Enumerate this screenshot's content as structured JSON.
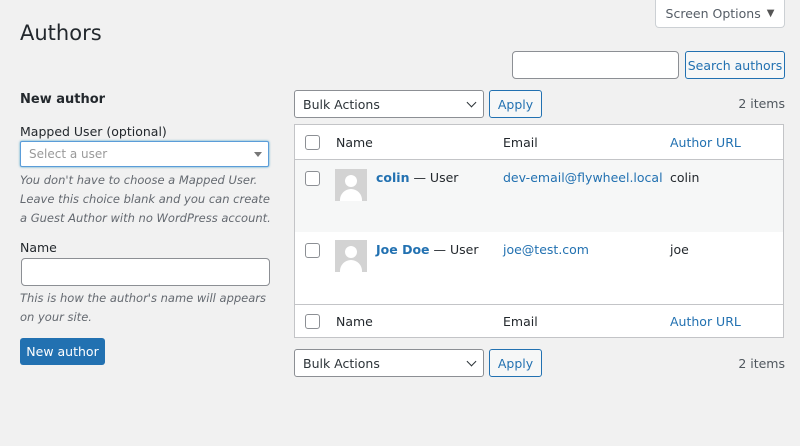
{
  "header": {
    "title": "Authors",
    "screen_options": "Screen Options",
    "search_button": "Search authors",
    "search_value": ""
  },
  "form": {
    "heading": "New author",
    "mapped_user_label": "Mapped User (optional)",
    "mapped_user_placeholder": "Select a user",
    "mapped_user_desc": "You don't have to choose a Mapped User. Leave this choice blank and you can create a Guest Author with no WordPress account.",
    "name_label": "Name",
    "name_value": "",
    "name_desc": "This is how the author's name will appears on your site.",
    "submit_label": "New author"
  },
  "bulk_top": {
    "action": "Bulk Actions",
    "apply": "Apply",
    "count": "2 items"
  },
  "bulk_bottom": {
    "action": "Bulk Actions",
    "apply": "Apply",
    "count": "2 items"
  },
  "table": {
    "columns": {
      "name": "Name",
      "email": "Email",
      "url": "Author URL"
    },
    "rows": [
      {
        "name": "colin",
        "role": "— User",
        "email": "dev-email@flywheel.local",
        "url": "colin"
      },
      {
        "name": "Joe Doe",
        "role": "— User",
        "email": "joe@test.com",
        "url": "joe"
      }
    ]
  },
  "colors": {
    "accent": "#2271b1",
    "background": "#f1f1f1"
  },
  "icons": [
    "chevron-down-icon",
    "avatar-placeholder-icon",
    "dropdown-caret-icon"
  ]
}
